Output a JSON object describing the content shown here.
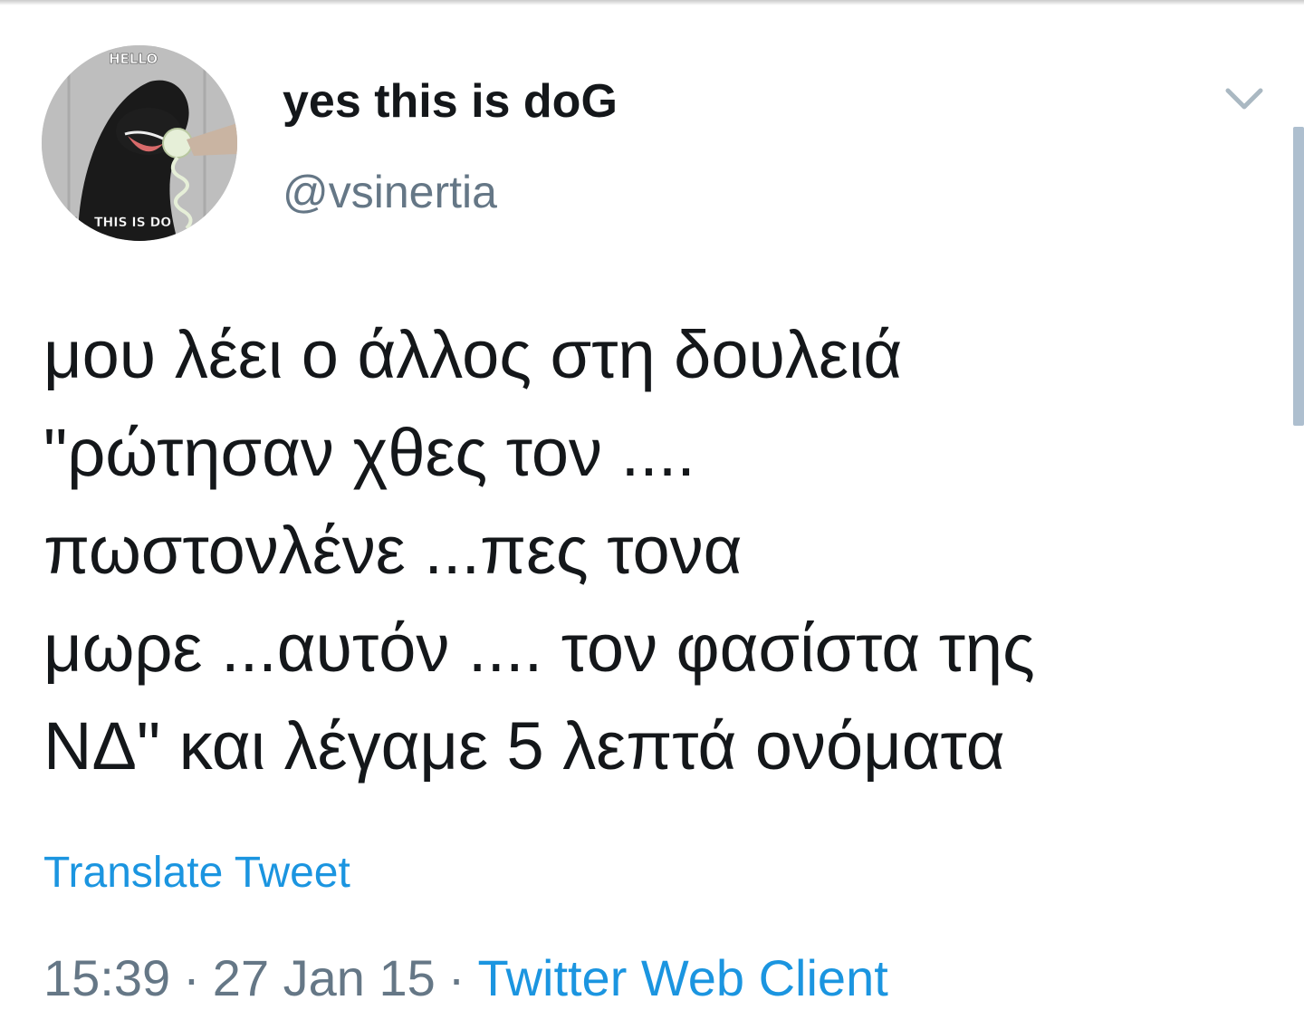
{
  "user": {
    "display_name": "yes this is doG",
    "handle": "@vsinertia",
    "avatar": {
      "top_text": "HELLO",
      "bottom_text": "THIS IS DO",
      "bottom_prefix": "S"
    }
  },
  "tweet": {
    "lines": [
      "μου λέει ο άλλος στη δουλειά",
      "\"ρώτησαν χθες τον ....",
      "πωστονλένε ...πες τονα",
      "μωρε ...αυτόν .... τον φασίστα της",
      "ΝΔ\" και λέγαμε 5 λεπτά ονόματα"
    ],
    "translate_label": "Translate Tweet",
    "time": "15:39",
    "date": "27 Jan 15",
    "separator": "·",
    "client": "Twitter Web Client"
  },
  "icons": {
    "menu": "chevron-down-icon"
  },
  "colors": {
    "text": "#14171a",
    "secondary": "#657786",
    "link": "#1b95e0"
  }
}
